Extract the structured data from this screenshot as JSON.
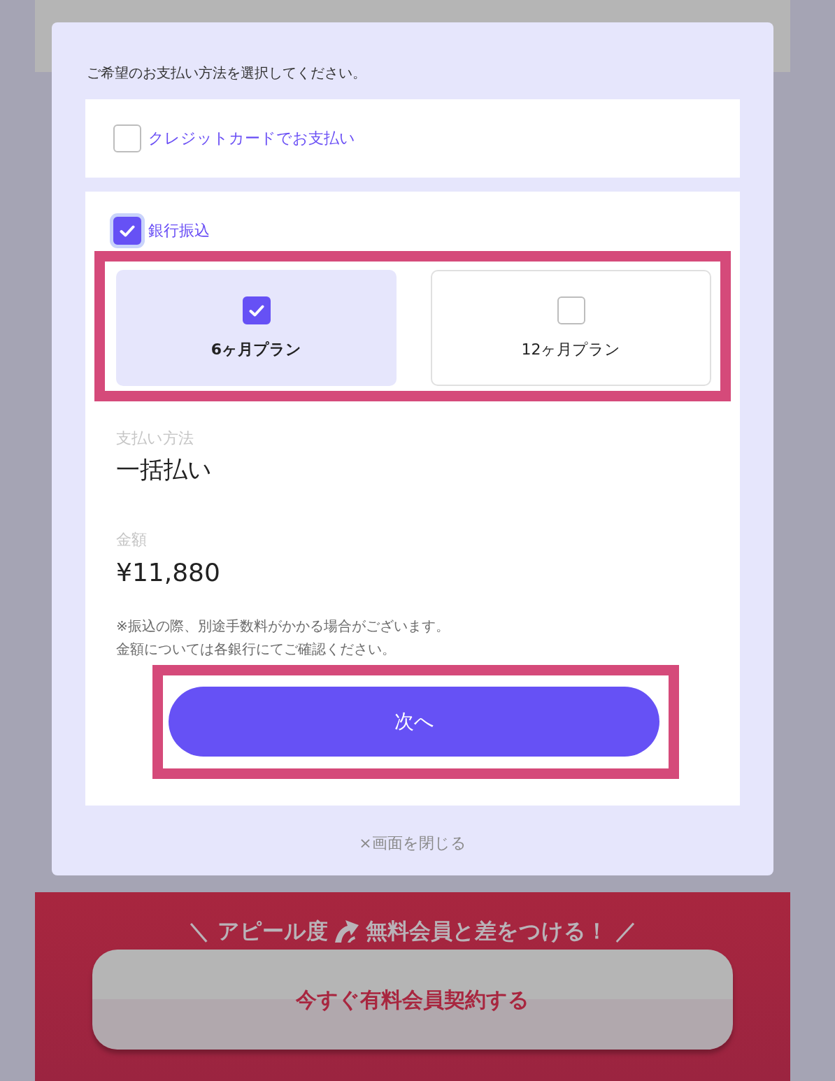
{
  "dialog": {
    "prompt": "ご希望のお支払い方法を選択してください。",
    "payment_methods": [
      {
        "label": "クレジットカードでお支払い",
        "checked": false,
        "focused": false
      },
      {
        "label": "銀行振込",
        "checked": true,
        "focused": true,
        "plans": {
          "highlighted": true,
          "items": [
            {
              "label": "6ヶ月プラン",
              "selected": true
            },
            {
              "label": "12ヶ月プラン",
              "selected": false
            }
          ]
        },
        "details": [
          {
            "label": "支払い方法",
            "value": "一括払い"
          },
          {
            "label": "金額",
            "value": "¥11,880"
          }
        ],
        "note_lines": [
          "※振込の際、別途手数料がかかる場合がございます。",
          "金額については各銀行にてご確認ください。"
        ],
        "next_button": {
          "label": "次へ",
          "highlighted": true
        }
      }
    ],
    "close_link": "×画面を閉じる"
  },
  "banner": {
    "tagline_start": "＼ アピール度",
    "tagline_end": "無料会員と差をつける！ ／",
    "button": "今すぐ有料会員契約する"
  }
}
